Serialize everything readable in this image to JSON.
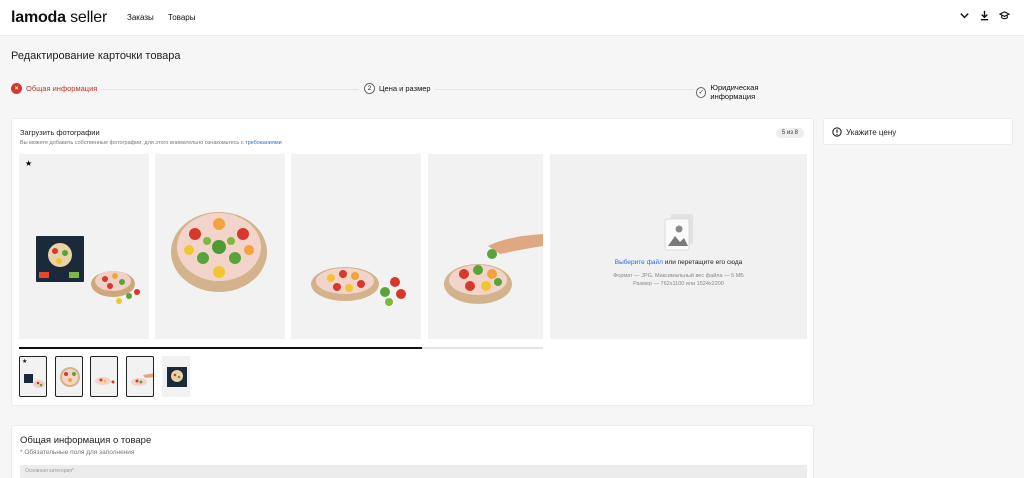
{
  "header": {
    "logo_brand": "lamoda",
    "logo_suffix": " seller",
    "nav": [
      "Заказы",
      "Товары"
    ],
    "icons": [
      "chevron-down-icon",
      "download-icon",
      "graduation-cap-icon"
    ]
  },
  "page": {
    "title": "Редактирование карточки товара"
  },
  "stepper": {
    "steps": [
      {
        "label": "Общая информация",
        "marker": "×",
        "state": "error"
      },
      {
        "label": "Цена и размер",
        "marker": "2",
        "state": "pending"
      },
      {
        "label": "Юридическая информация",
        "marker": "✓",
        "state": "pending"
      }
    ]
  },
  "upload": {
    "title": "Загрузить фотографии",
    "hint": "Вы можете добавить собственные фотографии, для этого внимательно ознакомьтесь с ",
    "hint_link": "требованиями",
    "count": "5 из 8",
    "main_star": "★",
    "drop_link": "Выберите файл",
    "drop_text": " или перетащите его сюда",
    "drop_format": "Формат — JPG. Максимальный вес файла — 5 МБ",
    "drop_size": "Размер — 762x1100 или 1524x2200",
    "scroll_progress": 0.77
  },
  "price": {
    "label": "Укажите цену"
  },
  "info": {
    "title": "Общая информация о товаре",
    "required_note": "* Обязательные поля для заполнения",
    "category_placeholder": "Основная категория*"
  },
  "colors": {
    "accent": "#d43a2a",
    "link": "#2b6fd6"
  }
}
